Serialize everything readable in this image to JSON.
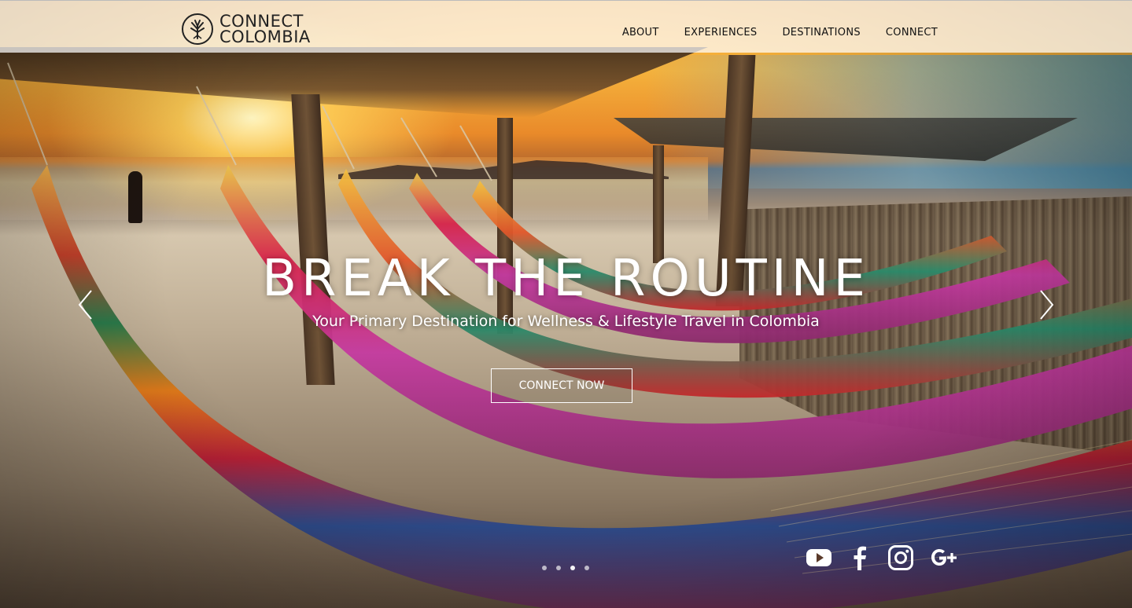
{
  "brand": {
    "line1": "CONNECT",
    "line2": "COLOMBIA"
  },
  "nav": {
    "items": [
      {
        "label": "ABOUT"
      },
      {
        "label": "EXPERIENCES"
      },
      {
        "label": "DESTINATIONS"
      },
      {
        "label": "CONNECT"
      }
    ]
  },
  "hero": {
    "headline": "BREAK THE ROUTINE",
    "subheadline": "Your Primary Destination for Wellness & Lifestyle Travel in Colombia",
    "cta_label": "CONNECT NOW",
    "slides_total": 4,
    "active_slide": 3
  },
  "social": {
    "icons": [
      "youtube-icon",
      "facebook-icon",
      "instagram-icon",
      "google-plus-icon"
    ]
  },
  "colors": {
    "header_bg": "#ffffffb8",
    "text_dark": "#111111",
    "text_light": "#ffffff"
  }
}
